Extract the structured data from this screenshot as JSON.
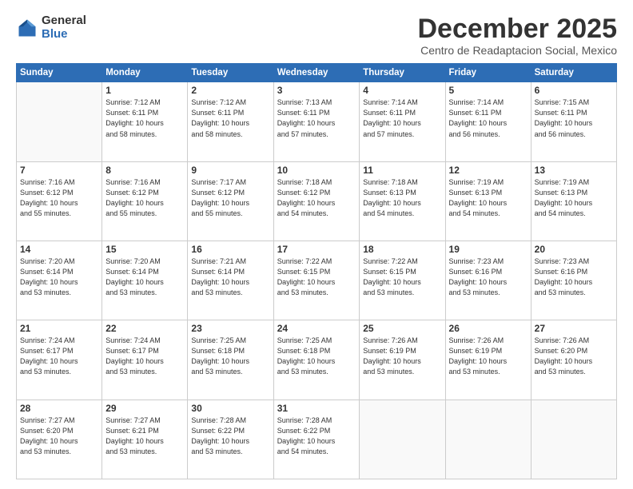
{
  "logo": {
    "general": "General",
    "blue": "Blue"
  },
  "header": {
    "month": "December 2025",
    "location": "Centro de Readaptacion Social, Mexico"
  },
  "days_header": [
    "Sunday",
    "Monday",
    "Tuesday",
    "Wednesday",
    "Thursday",
    "Friday",
    "Saturday"
  ],
  "weeks": [
    [
      {
        "num": "",
        "info": ""
      },
      {
        "num": "1",
        "info": "Sunrise: 7:12 AM\nSunset: 6:11 PM\nDaylight: 10 hours\nand 58 minutes."
      },
      {
        "num": "2",
        "info": "Sunrise: 7:12 AM\nSunset: 6:11 PM\nDaylight: 10 hours\nand 58 minutes."
      },
      {
        "num": "3",
        "info": "Sunrise: 7:13 AM\nSunset: 6:11 PM\nDaylight: 10 hours\nand 57 minutes."
      },
      {
        "num": "4",
        "info": "Sunrise: 7:14 AM\nSunset: 6:11 PM\nDaylight: 10 hours\nand 57 minutes."
      },
      {
        "num": "5",
        "info": "Sunrise: 7:14 AM\nSunset: 6:11 PM\nDaylight: 10 hours\nand 56 minutes."
      },
      {
        "num": "6",
        "info": "Sunrise: 7:15 AM\nSunset: 6:11 PM\nDaylight: 10 hours\nand 56 minutes."
      }
    ],
    [
      {
        "num": "7",
        "info": "Sunrise: 7:16 AM\nSunset: 6:12 PM\nDaylight: 10 hours\nand 55 minutes."
      },
      {
        "num": "8",
        "info": "Sunrise: 7:16 AM\nSunset: 6:12 PM\nDaylight: 10 hours\nand 55 minutes."
      },
      {
        "num": "9",
        "info": "Sunrise: 7:17 AM\nSunset: 6:12 PM\nDaylight: 10 hours\nand 55 minutes."
      },
      {
        "num": "10",
        "info": "Sunrise: 7:18 AM\nSunset: 6:12 PM\nDaylight: 10 hours\nand 54 minutes."
      },
      {
        "num": "11",
        "info": "Sunrise: 7:18 AM\nSunset: 6:13 PM\nDaylight: 10 hours\nand 54 minutes."
      },
      {
        "num": "12",
        "info": "Sunrise: 7:19 AM\nSunset: 6:13 PM\nDaylight: 10 hours\nand 54 minutes."
      },
      {
        "num": "13",
        "info": "Sunrise: 7:19 AM\nSunset: 6:13 PM\nDaylight: 10 hours\nand 54 minutes."
      }
    ],
    [
      {
        "num": "14",
        "info": "Sunrise: 7:20 AM\nSunset: 6:14 PM\nDaylight: 10 hours\nand 53 minutes."
      },
      {
        "num": "15",
        "info": "Sunrise: 7:20 AM\nSunset: 6:14 PM\nDaylight: 10 hours\nand 53 minutes."
      },
      {
        "num": "16",
        "info": "Sunrise: 7:21 AM\nSunset: 6:14 PM\nDaylight: 10 hours\nand 53 minutes."
      },
      {
        "num": "17",
        "info": "Sunrise: 7:22 AM\nSunset: 6:15 PM\nDaylight: 10 hours\nand 53 minutes."
      },
      {
        "num": "18",
        "info": "Sunrise: 7:22 AM\nSunset: 6:15 PM\nDaylight: 10 hours\nand 53 minutes."
      },
      {
        "num": "19",
        "info": "Sunrise: 7:23 AM\nSunset: 6:16 PM\nDaylight: 10 hours\nand 53 minutes."
      },
      {
        "num": "20",
        "info": "Sunrise: 7:23 AM\nSunset: 6:16 PM\nDaylight: 10 hours\nand 53 minutes."
      }
    ],
    [
      {
        "num": "21",
        "info": "Sunrise: 7:24 AM\nSunset: 6:17 PM\nDaylight: 10 hours\nand 53 minutes."
      },
      {
        "num": "22",
        "info": "Sunrise: 7:24 AM\nSunset: 6:17 PM\nDaylight: 10 hours\nand 53 minutes."
      },
      {
        "num": "23",
        "info": "Sunrise: 7:25 AM\nSunset: 6:18 PM\nDaylight: 10 hours\nand 53 minutes."
      },
      {
        "num": "24",
        "info": "Sunrise: 7:25 AM\nSunset: 6:18 PM\nDaylight: 10 hours\nand 53 minutes."
      },
      {
        "num": "25",
        "info": "Sunrise: 7:26 AM\nSunset: 6:19 PM\nDaylight: 10 hours\nand 53 minutes."
      },
      {
        "num": "26",
        "info": "Sunrise: 7:26 AM\nSunset: 6:19 PM\nDaylight: 10 hours\nand 53 minutes."
      },
      {
        "num": "27",
        "info": "Sunrise: 7:26 AM\nSunset: 6:20 PM\nDaylight: 10 hours\nand 53 minutes."
      }
    ],
    [
      {
        "num": "28",
        "info": "Sunrise: 7:27 AM\nSunset: 6:20 PM\nDaylight: 10 hours\nand 53 minutes."
      },
      {
        "num": "29",
        "info": "Sunrise: 7:27 AM\nSunset: 6:21 PM\nDaylight: 10 hours\nand 53 minutes."
      },
      {
        "num": "30",
        "info": "Sunrise: 7:28 AM\nSunset: 6:22 PM\nDaylight: 10 hours\nand 53 minutes."
      },
      {
        "num": "31",
        "info": "Sunrise: 7:28 AM\nSunset: 6:22 PM\nDaylight: 10 hours\nand 54 minutes."
      },
      {
        "num": "",
        "info": ""
      },
      {
        "num": "",
        "info": ""
      },
      {
        "num": "",
        "info": ""
      }
    ]
  ]
}
